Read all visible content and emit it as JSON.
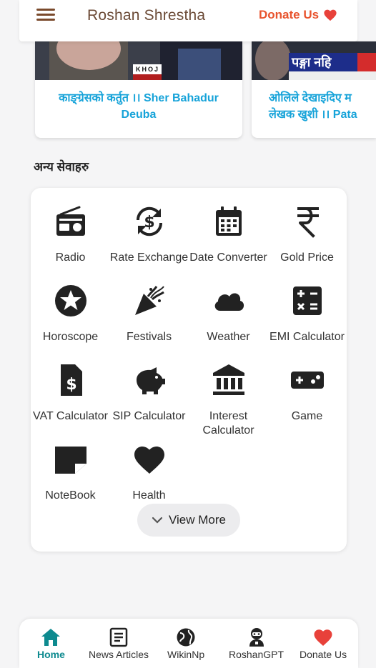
{
  "header": {
    "title": "Roshan Shrestha",
    "donate_label": "Donate Us"
  },
  "news": [
    {
      "caption_line1": "काङ्ग्रेसको कर्तुत ।। Sher Bahadur",
      "caption_line2": "Deuba",
      "thumb_badge": "KHOJ"
    },
    {
      "caption_line1": "ओलिले देखाइदिए म",
      "caption_line2": "लेखक खुशी ।। Pata",
      "thumb_badge": "पङ्गा नहि"
    }
  ],
  "section_title": "अन्य सेवाहरु",
  "services": [
    {
      "label": "Radio",
      "icon": "radio-icon"
    },
    {
      "label": "Rate Exchange",
      "icon": "currency-exchange-icon"
    },
    {
      "label": "Date Converter",
      "icon": "calendar-icon"
    },
    {
      "label": "Gold Price",
      "icon": "rupee-icon"
    },
    {
      "label": "Horoscope",
      "icon": "star-icon"
    },
    {
      "label": "Festivals",
      "icon": "party-popper-icon"
    },
    {
      "label": "Weather",
      "icon": "cloud-icon"
    },
    {
      "label": "EMI Calculator",
      "icon": "calculator-icon"
    },
    {
      "label": "VAT Calculator",
      "icon": "dollar-document-icon"
    },
    {
      "label": "SIP Calculator",
      "icon": "piggy-bank-icon"
    },
    {
      "label": "Interest Calculator",
      "icon": "bank-icon"
    },
    {
      "label": "Game",
      "icon": "gamepad-icon"
    },
    {
      "label": "NoteBook",
      "icon": "note-icon"
    },
    {
      "label": "Health",
      "icon": "heart-icon"
    }
  ],
  "view_more_label": "View More",
  "bottom_nav": [
    {
      "label": "Home",
      "icon": "home-icon",
      "active": true
    },
    {
      "label": "News Articles",
      "icon": "article-icon",
      "active": false
    },
    {
      "label": "WikinNp",
      "icon": "globe-icon",
      "active": false
    },
    {
      "label": "RoshanGPT",
      "icon": "robot-icon",
      "active": false
    },
    {
      "label": "Donate Us",
      "icon": "heart-icon",
      "active": false
    }
  ],
  "colors": {
    "accent": "#e8542e",
    "caption": "#16a3d9",
    "active_nav": "#0d8a8f",
    "heart": "#e8413a"
  }
}
